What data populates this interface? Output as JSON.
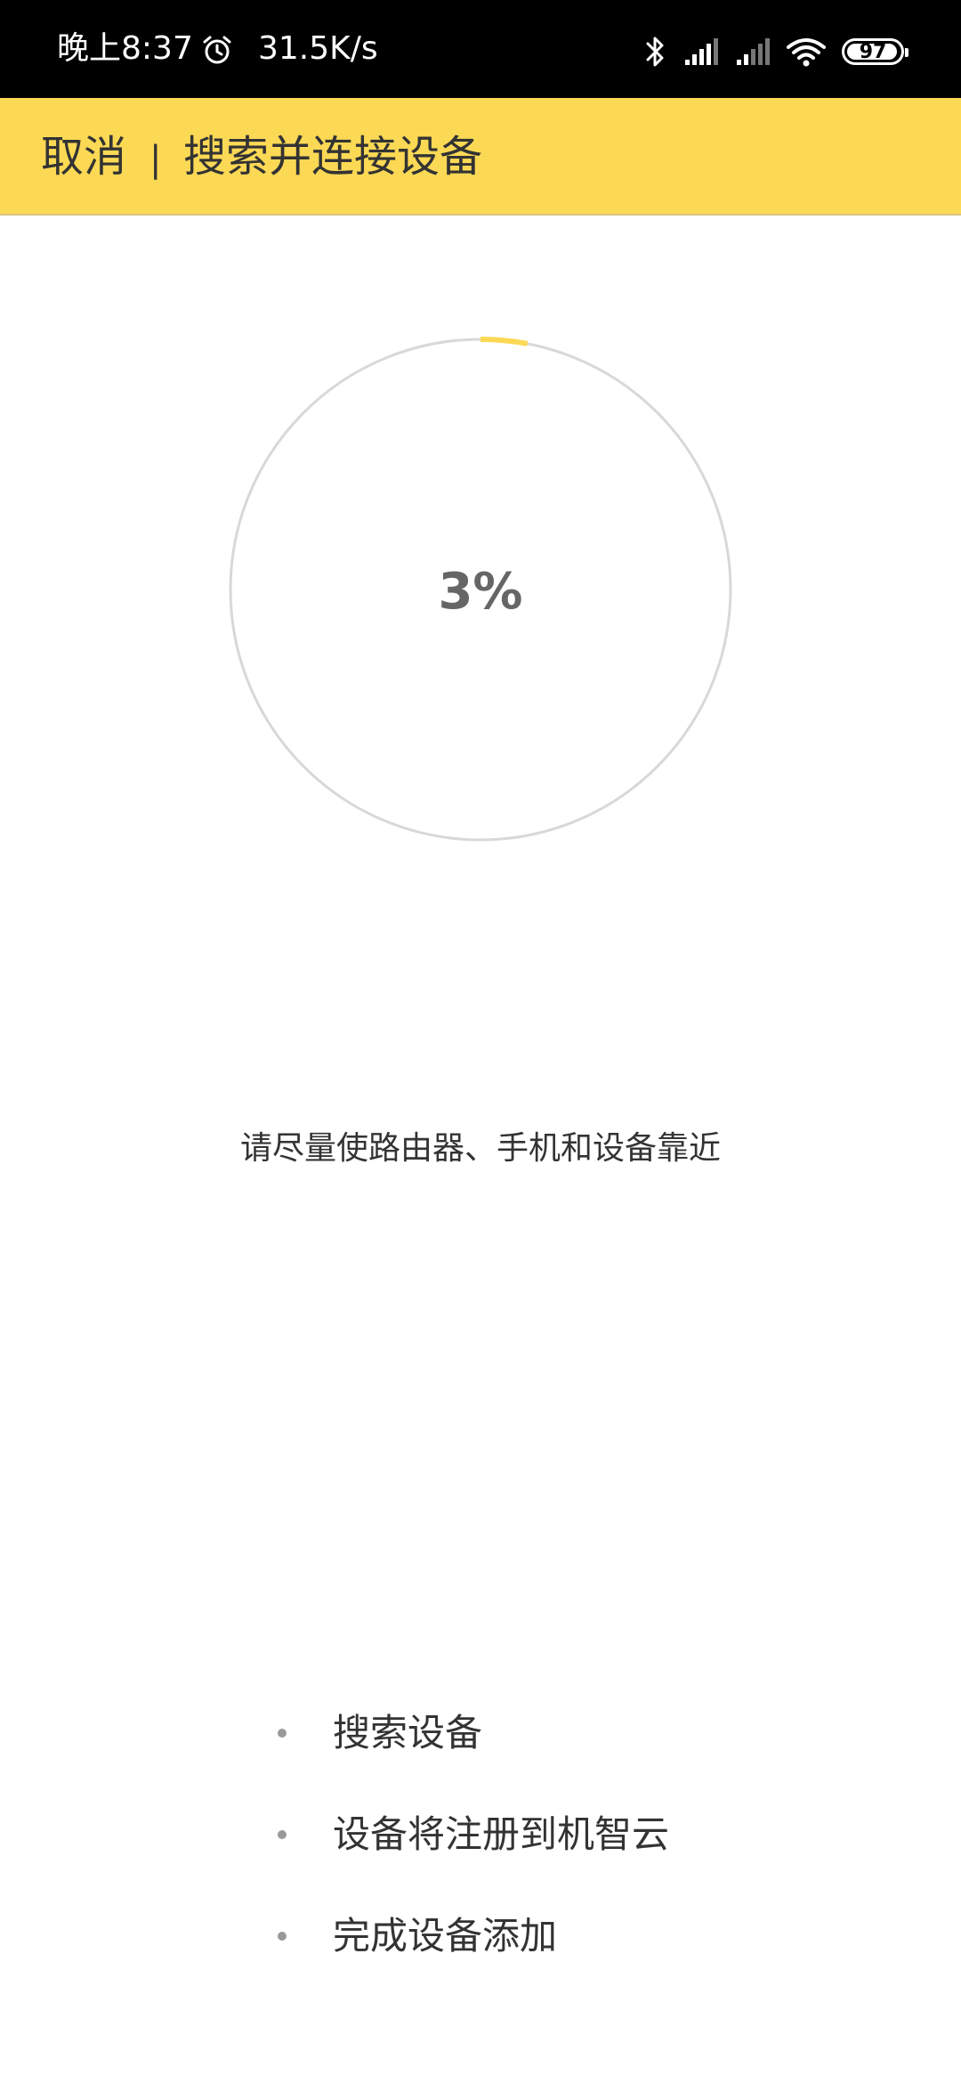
{
  "status_bar": {
    "time": "晚上8:37",
    "network_speed": "31.5K/s",
    "battery_level": "97",
    "icons": [
      "alarm-icon",
      "bluetooth-icon",
      "signal-icon",
      "signal-icon",
      "wifi-icon",
      "battery-icon"
    ]
  },
  "header": {
    "cancel_label": "取消",
    "divider": "|",
    "title": "搜索并连接设备",
    "background_color": "#fcd955"
  },
  "progress": {
    "percent_label": "3%",
    "value": 0.03,
    "accent_color": "#fcd955",
    "track_color": "#d8d8d8"
  },
  "hint": "请尽量使路由器、手机和设备靠近",
  "steps": [
    {
      "label": "搜索设备"
    },
    {
      "label": "设备将注册到机智云"
    },
    {
      "label": "完成设备添加"
    }
  ]
}
